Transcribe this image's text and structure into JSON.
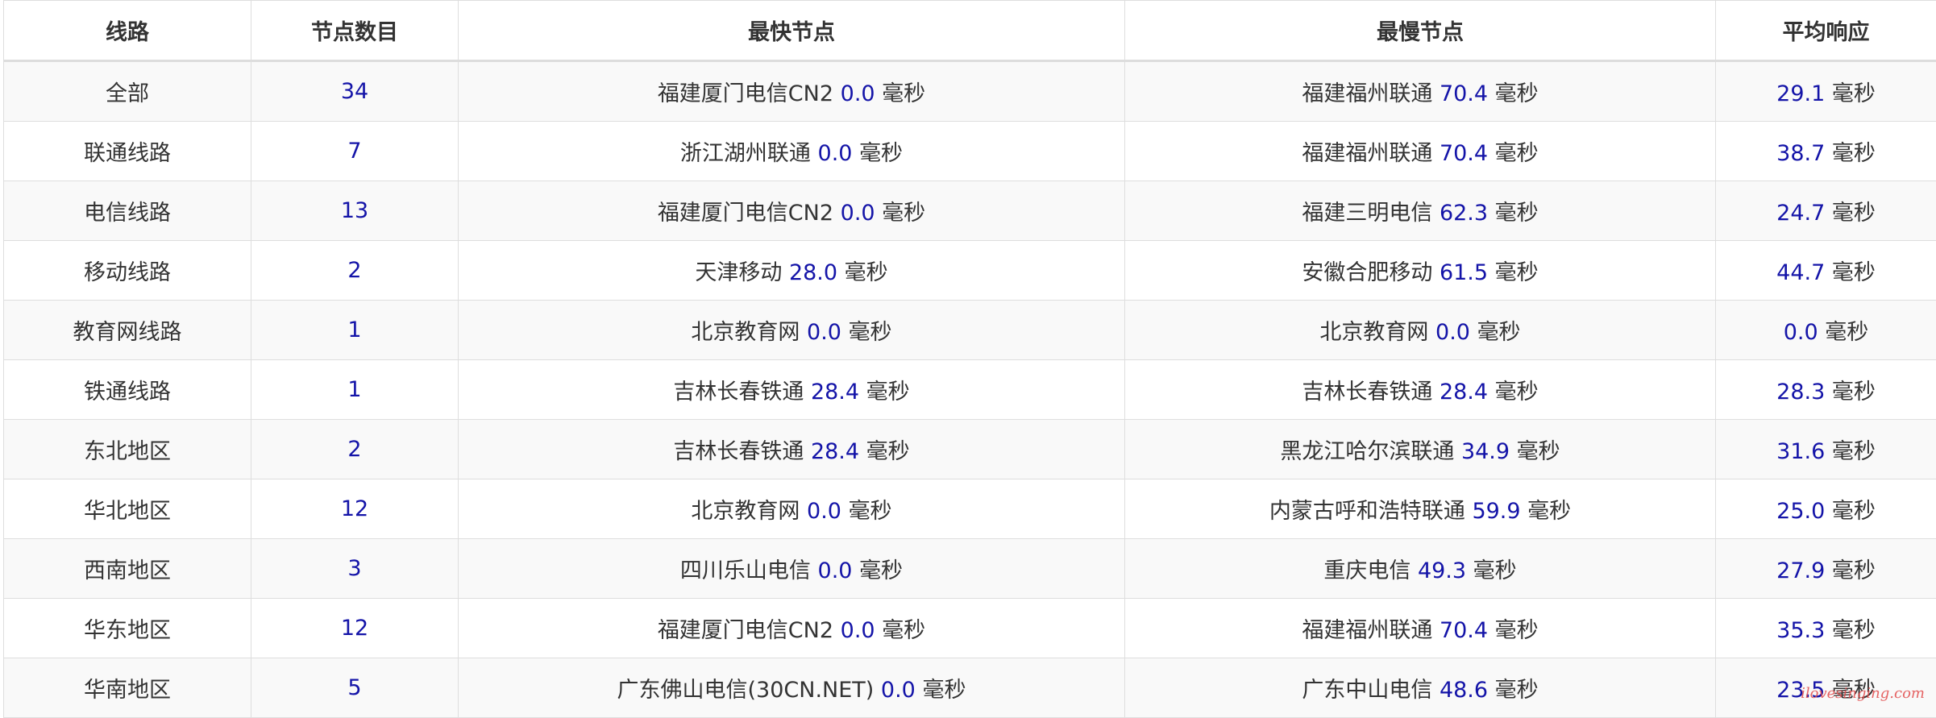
{
  "table": {
    "headers": [
      "线路",
      "节点数目",
      "最快节点",
      "最慢节点",
      "平均响应"
    ],
    "rows": [
      {
        "route": "全部",
        "count": "34",
        "fastest_node": "福建厦门电信CN2",
        "fastest_value": "0.0",
        "slowest_node": "福建福州联通",
        "slowest_value": "70.4",
        "avg_value": "29.1",
        "unit": "毫秒"
      },
      {
        "route": "联通线路",
        "count": "7",
        "fastest_node": "浙江湖州联通",
        "fastest_value": "0.0",
        "slowest_node": "福建福州联通",
        "slowest_value": "70.4",
        "avg_value": "38.7",
        "unit": "毫秒"
      },
      {
        "route": "电信线路",
        "count": "13",
        "fastest_node": "福建厦门电信CN2",
        "fastest_value": "0.0",
        "slowest_node": "福建三明电信",
        "slowest_value": "62.3",
        "avg_value": "24.7",
        "unit": "毫秒"
      },
      {
        "route": "移动线路",
        "count": "2",
        "fastest_node": "天津移动",
        "fastest_value": "28.0",
        "slowest_node": "安徽合肥移动",
        "slowest_value": "61.5",
        "avg_value": "44.7",
        "unit": "毫秒"
      },
      {
        "route": "教育网线路",
        "count": "1",
        "fastest_node": "北京教育网",
        "fastest_value": "0.0",
        "slowest_node": "北京教育网",
        "slowest_value": "0.0",
        "avg_value": "0.0",
        "unit": "毫秒"
      },
      {
        "route": "铁通线路",
        "count": "1",
        "fastest_node": "吉林长春铁通",
        "fastest_value": "28.4",
        "slowest_node": "吉林长春铁通",
        "slowest_value": "28.4",
        "avg_value": "28.3",
        "unit": "毫秒"
      },
      {
        "route": "东北地区",
        "count": "2",
        "fastest_node": "吉林长春铁通",
        "fastest_value": "28.4",
        "slowest_node": "黑龙江哈尔滨联通",
        "slowest_value": "34.9",
        "avg_value": "31.6",
        "unit": "毫秒"
      },
      {
        "route": "华北地区",
        "count": "12",
        "fastest_node": "北京教育网",
        "fastest_value": "0.0",
        "slowest_node": "内蒙古呼和浩特联通",
        "slowest_value": "59.9",
        "avg_value": "25.0",
        "unit": "毫秒"
      },
      {
        "route": "西南地区",
        "count": "3",
        "fastest_node": "四川乐山电信",
        "fastest_value": "0.0",
        "slowest_node": "重庆电信",
        "slowest_value": "49.3",
        "avg_value": "27.9",
        "unit": "毫秒"
      },
      {
        "route": "华东地区",
        "count": "12",
        "fastest_node": "福建厦门电信CN2",
        "fastest_value": "0.0",
        "slowest_node": "福建福州联通",
        "slowest_value": "70.4",
        "avg_value": "35.3",
        "unit": "毫秒"
      },
      {
        "route": "华南地区",
        "count": "5",
        "fastest_node": "广东佛山电信(30CN.NET)",
        "fastest_value": "0.0",
        "slowest_node": "广东中山电信",
        "slowest_value": "48.6",
        "avg_value": "23.5",
        "unit": "毫秒"
      }
    ]
  },
  "watermark": "ilovesinging.com",
  "colors": {
    "number": "#1414a8",
    "text": "#333333",
    "border": "#dedede",
    "stripe": "#f9f9f9",
    "watermark": "#e24a4a"
  }
}
